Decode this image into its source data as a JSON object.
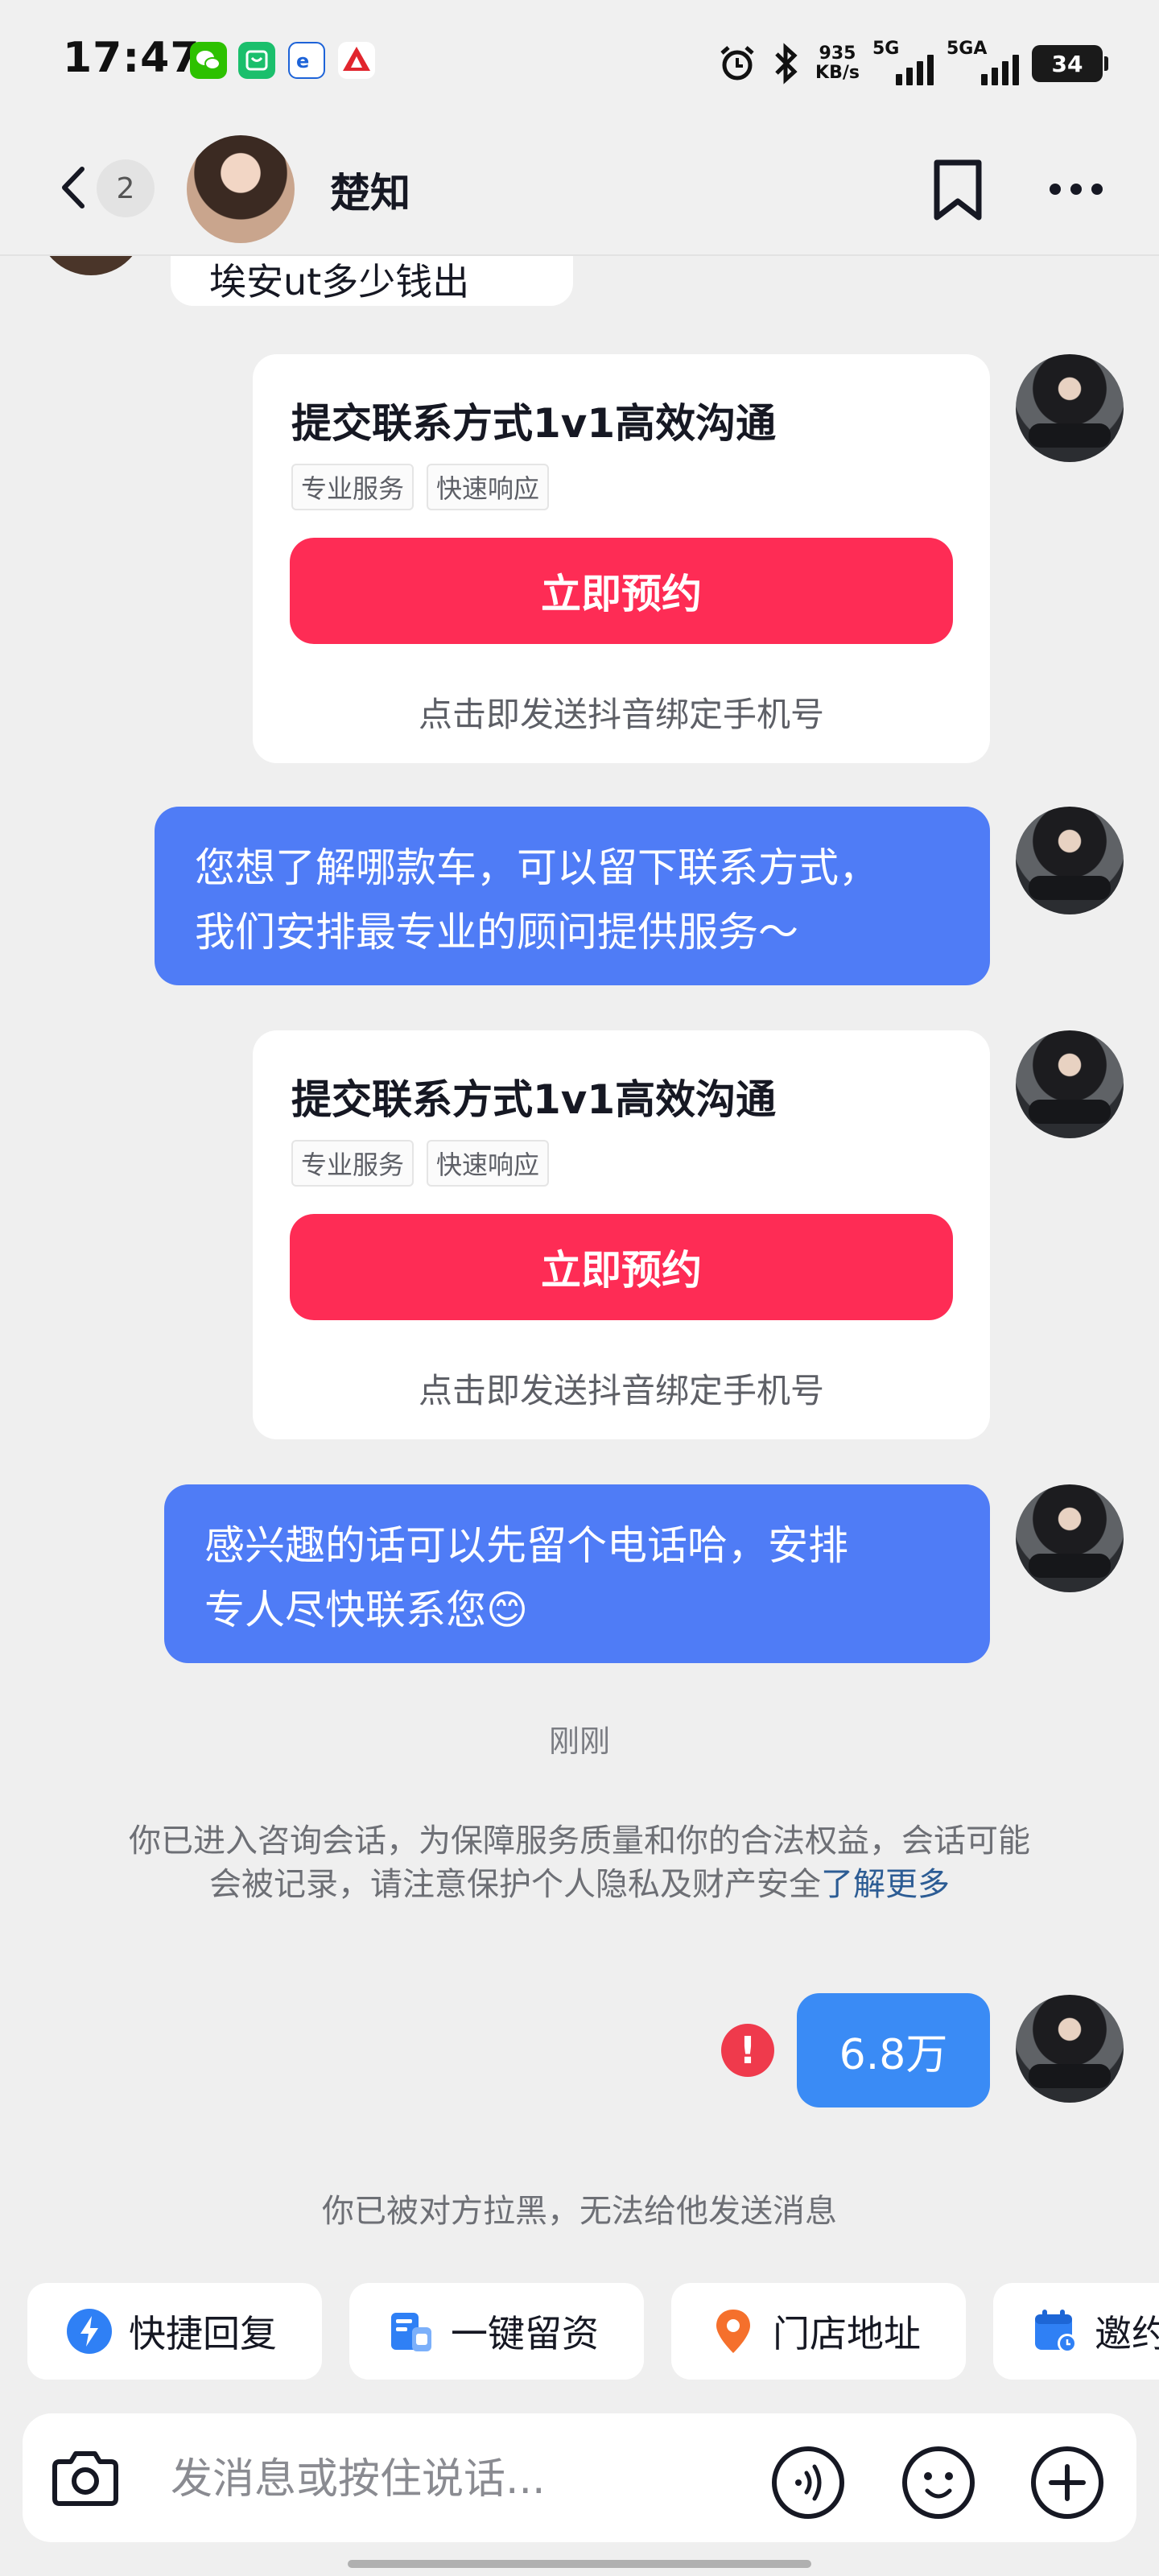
{
  "status_bar": {
    "time": "17:47",
    "speed_value": "935",
    "speed_unit": "KB/s",
    "net1": "5G",
    "net2": "5GA",
    "battery": "34"
  },
  "header": {
    "unread_count": "2",
    "contact_name": "楚知"
  },
  "messages": {
    "peer_partial_text": "埃安ut多少钱出",
    "card1": {
      "title": "提交联系方式1v1高效沟通",
      "tags": [
        "专业服务",
        "快速响应"
      ],
      "button": "立即预约",
      "note": "点击即发送抖音绑定手机号"
    },
    "bubble1_line1": "您想了解哪款车，可以留下联系方式，",
    "bubble1_line2": "我们安排最专业的顾问提供服务～",
    "card2": {
      "title": "提交联系方式1v1高效沟通",
      "tags": [
        "专业服务",
        "快速响应"
      ],
      "button": "立即预约",
      "note": "点击即发送抖音绑定手机号"
    },
    "bubble2_line1": "感兴趣的话可以先留个电话哈，安排",
    "bubble2_line2": "专人尽快联系您😊",
    "timestamp": "刚刚",
    "notice_text": "你已进入咨询会话，为保障服务质量和你的合法权益，会话可能会被记录，请注意保护个人隐私及财产安全",
    "notice_link": "了解更多",
    "error_mark": "!",
    "sent_price": "6.8万",
    "blocked_notice": "你已被对方拉黑，无法给他发送消息"
  },
  "quick_actions": [
    {
      "label": "快捷回复",
      "icon": "lightning-icon"
    },
    {
      "label": "一键留资",
      "icon": "form-icon"
    },
    {
      "label": "门店地址",
      "icon": "location-pin-icon"
    },
    {
      "label": "邀约",
      "icon": "calendar-icon"
    }
  ],
  "input_bar": {
    "placeholder": "发消息或按住说话..."
  },
  "colors": {
    "accent_red": "#fe2c55",
    "bubble_blue": "#4f7cf6",
    "price_blue": "#3a8bf5",
    "error_red": "#ef3a4c",
    "link_blue": "#2c5c94"
  }
}
